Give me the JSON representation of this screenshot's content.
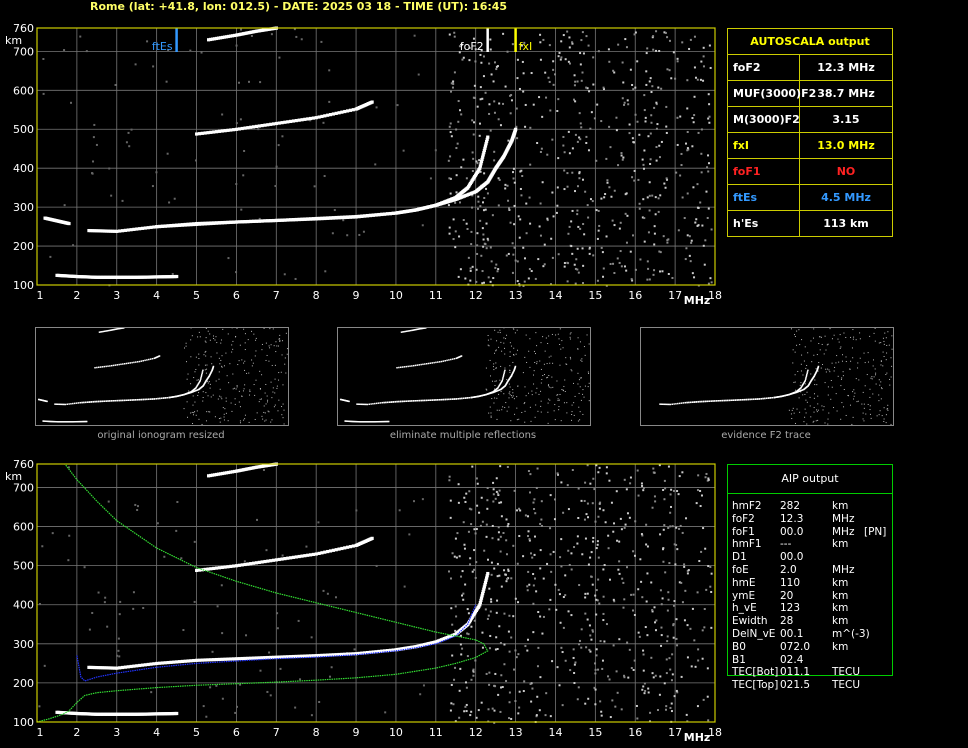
{
  "header": {
    "title": "Rome (lat: +41.8, lon: 012.5) - DATE: 2025 03 18 - TIME (UT): 16:45"
  },
  "colors": {
    "axis": "#cccc00",
    "grid": "#777777",
    "trace": "#ffffff",
    "fxI": "#ffff00",
    "foF1": "#ff3333",
    "ftEs": "#3399ff",
    "profile_green": "#33dd33",
    "profile_blue": "#2233ff"
  },
  "autoscala": {
    "title": "AUTOSCALA output",
    "rows": [
      {
        "label": "foF2",
        "value": "12.3 MHz",
        "color": "#ffffff"
      },
      {
        "label": "MUF(3000)F2",
        "value": "38.7 MHz",
        "color": "#ffffff"
      },
      {
        "label": "M(3000)F2",
        "value": "3.15",
        "color": "#ffffff"
      },
      {
        "label": "fxI",
        "value": "13.0 MHz",
        "color": "#ffff00"
      },
      {
        "label": "foF1",
        "value": "NO",
        "color": "#ff2222"
      },
      {
        "label": "ftEs",
        "value": "4.5 MHz",
        "color": "#3399ff"
      },
      {
        "label": "h'Es",
        "value": "113    km",
        "color": "#ffffff"
      }
    ]
  },
  "aip": {
    "title": "AIP output",
    "rows": [
      {
        "label": "hmF2",
        "value": "282",
        "unit": "km",
        "extra": ""
      },
      {
        "label": "foF2",
        "value": "12.3",
        "unit": "MHz",
        "extra": ""
      },
      {
        "label": "foF1",
        "value": "00.0",
        "unit": "MHz",
        "extra": "[PN]"
      },
      {
        "label": "hmF1",
        "value": "---",
        "unit": "km",
        "extra": ""
      },
      {
        "label": "D1",
        "value": "00.0",
        "unit": "",
        "extra": ""
      },
      {
        "label": "foE",
        "value": "2.0",
        "unit": "MHz",
        "extra": ""
      },
      {
        "label": "hmE",
        "value": "110",
        "unit": "km",
        "extra": ""
      },
      {
        "label": "ymE",
        "value": "20",
        "unit": "km",
        "extra": ""
      },
      {
        "label": "h_vE",
        "value": "123",
        "unit": "km",
        "extra": ""
      },
      {
        "label": "Ewidth",
        "value": "28",
        "unit": "km",
        "extra": ""
      },
      {
        "label": "DelN_vE",
        "value": "00.1",
        "unit": "m^(-3)",
        "extra": ""
      },
      {
        "label": "B0",
        "value": "072.0",
        "unit": "km",
        "extra": ""
      },
      {
        "label": "B1",
        "value": "02.4",
        "unit": "",
        "extra": ""
      },
      {
        "label": "TEC[Bot]",
        "value": "011.1",
        "unit": "TECU",
        "extra": ""
      },
      {
        "label": "TEC[Top]",
        "value": "021.5",
        "unit": "TECU",
        "extra": ""
      }
    ]
  },
  "thumbnails": [
    {
      "caption": "original ionogram resized"
    },
    {
      "caption": "eliminate multiple reflections"
    },
    {
      "caption": "evidence F2 trace"
    }
  ],
  "chart_data": [
    {
      "type": "scatter",
      "xlabel": "MHz",
      "ylabel": "km",
      "xlim": [
        1,
        18
      ],
      "ylim": [
        100,
        760
      ],
      "xticks": [
        1,
        2,
        3,
        4,
        5,
        6,
        7,
        8,
        9,
        10,
        11,
        12,
        13,
        14,
        15,
        16,
        17,
        18
      ],
      "yticks": [
        100,
        200,
        300,
        400,
        500,
        600,
        700,
        760
      ],
      "grid": true,
      "markers": [
        {
          "label": "ftEs",
          "x": 4.5,
          "color": "#3399ff"
        },
        {
          "label": "foF2",
          "x": 12.3,
          "color": "#ffffff"
        },
        {
          "label": "fxI",
          "x": 13.0,
          "color": "#ffff00"
        }
      ],
      "series": [
        {
          "x": [
            1.5,
            2.0,
            2.5,
            3.0,
            3.5,
            4.0,
            4.5
          ],
          "y": [
            125,
            122,
            120,
            120,
            120,
            121,
            122
          ]
        },
        {
          "x": [
            1.2,
            1.5,
            1.8
          ],
          "y": [
            272,
            265,
            258
          ]
        },
        {
          "x": [
            2.3,
            3.0,
            4.0,
            5.0,
            6.0,
            7.0,
            8.0,
            9.0,
            10.0,
            10.5,
            11.0,
            11.5,
            11.8,
            12.1,
            12.3
          ],
          "y": [
            240,
            238,
            250,
            258,
            262,
            266,
            270,
            275,
            285,
            293,
            305,
            325,
            350,
            400,
            480
          ]
        },
        {
          "x": [
            4.0,
            5.0,
            6.0,
            7.0,
            8.0,
            9.0,
            10.0,
            10.5,
            11.0,
            11.5,
            12.0,
            12.3,
            12.5,
            12.7,
            12.9,
            13.0
          ],
          "y": [
            250,
            256,
            262,
            266,
            271,
            276,
            285,
            293,
            305,
            320,
            340,
            365,
            400,
            430,
            470,
            500
          ]
        },
        {
          "x": [
            5.0,
            6.0,
            7.0,
            8.0,
            9.0,
            9.4
          ],
          "y": [
            488,
            500,
            515,
            530,
            552,
            570
          ]
        },
        {
          "x": [
            5.3,
            6.0,
            6.5,
            7.0
          ],
          "y": [
            730,
            742,
            752,
            760
          ]
        }
      ]
    },
    {
      "type": "line",
      "xlabel": "MHz",
      "ylabel": "km",
      "xlim": [
        1,
        18
      ],
      "ylim": [
        100,
        760
      ],
      "xticks": [
        1,
        2,
        3,
        4,
        5,
        6,
        7,
        8,
        9,
        10,
        11,
        12,
        13,
        14,
        15,
        16,
        17,
        18
      ],
      "yticks": [
        100,
        200,
        300,
        400,
        500,
        600,
        700,
        760
      ],
      "grid": true,
      "series": [
        {
          "x": [
            1.5,
            2.0,
            2.5,
            3.0,
            3.5,
            4.0,
            4.5
          ],
          "y": [
            125,
            122,
            120,
            120,
            120,
            121,
            122
          ]
        },
        {
          "x": [
            2.3,
            3.0,
            4.0,
            5.0,
            6.0,
            7.0,
            8.0,
            9.0,
            10.0,
            10.5,
            11.0,
            11.5,
            11.8,
            12.1,
            12.3
          ],
          "y": [
            240,
            238,
            250,
            258,
            262,
            266,
            270,
            275,
            285,
            293,
            305,
            325,
            350,
            400,
            480
          ]
        },
        {
          "x": [
            5.0,
            6.0,
            7.0,
            8.0,
            9.0,
            9.4
          ],
          "y": [
            488,
            500,
            515,
            530,
            552,
            570
          ]
        },
        {
          "x": [
            5.3,
            6.0,
            6.5,
            7.0
          ],
          "y": [
            730,
            742,
            752,
            760
          ]
        },
        {
          "x": [
            2.0,
            2.1,
            2.2,
            2.5,
            3.0,
            4.0,
            5.0,
            6.0,
            7.0,
            8.0,
            9.0,
            10.0,
            10.5,
            11.0,
            11.5,
            11.8,
            12.0
          ],
          "y": [
            270,
            215,
            205,
            215,
            225,
            240,
            250,
            256,
            262,
            266,
            272,
            282,
            290,
            300,
            320,
            350,
            400
          ],
          "color": "#2233ff"
        },
        {
          "x": [
            1.0,
            1.3,
            1.6,
            1.8,
            2.0,
            2.2,
            2.5,
            3.0,
            4.0,
            5.0,
            6.0,
            7.0,
            8.0,
            9.0,
            10.0,
            11.0,
            11.5,
            12.0,
            12.3,
            12.2,
            12.0
          ],
          "y": [
            100,
            108,
            118,
            128,
            150,
            168,
            175,
            180,
            188,
            194,
            198,
            202,
            207,
            213,
            222,
            238,
            250,
            265,
            282,
            300,
            310
          ],
          "color": "#33dd33"
        },
        {
          "x": [
            12.0,
            11.0,
            10.0,
            9.0,
            8.0,
            7.0,
            6.0,
            5.0,
            4.0,
            3.0,
            2.5,
            2.0,
            1.7
          ],
          "y": [
            310,
            330,
            355,
            380,
            405,
            430,
            460,
            495,
            545,
            615,
            665,
            720,
            760
          ],
          "color": "#33dd33"
        }
      ]
    }
  ]
}
